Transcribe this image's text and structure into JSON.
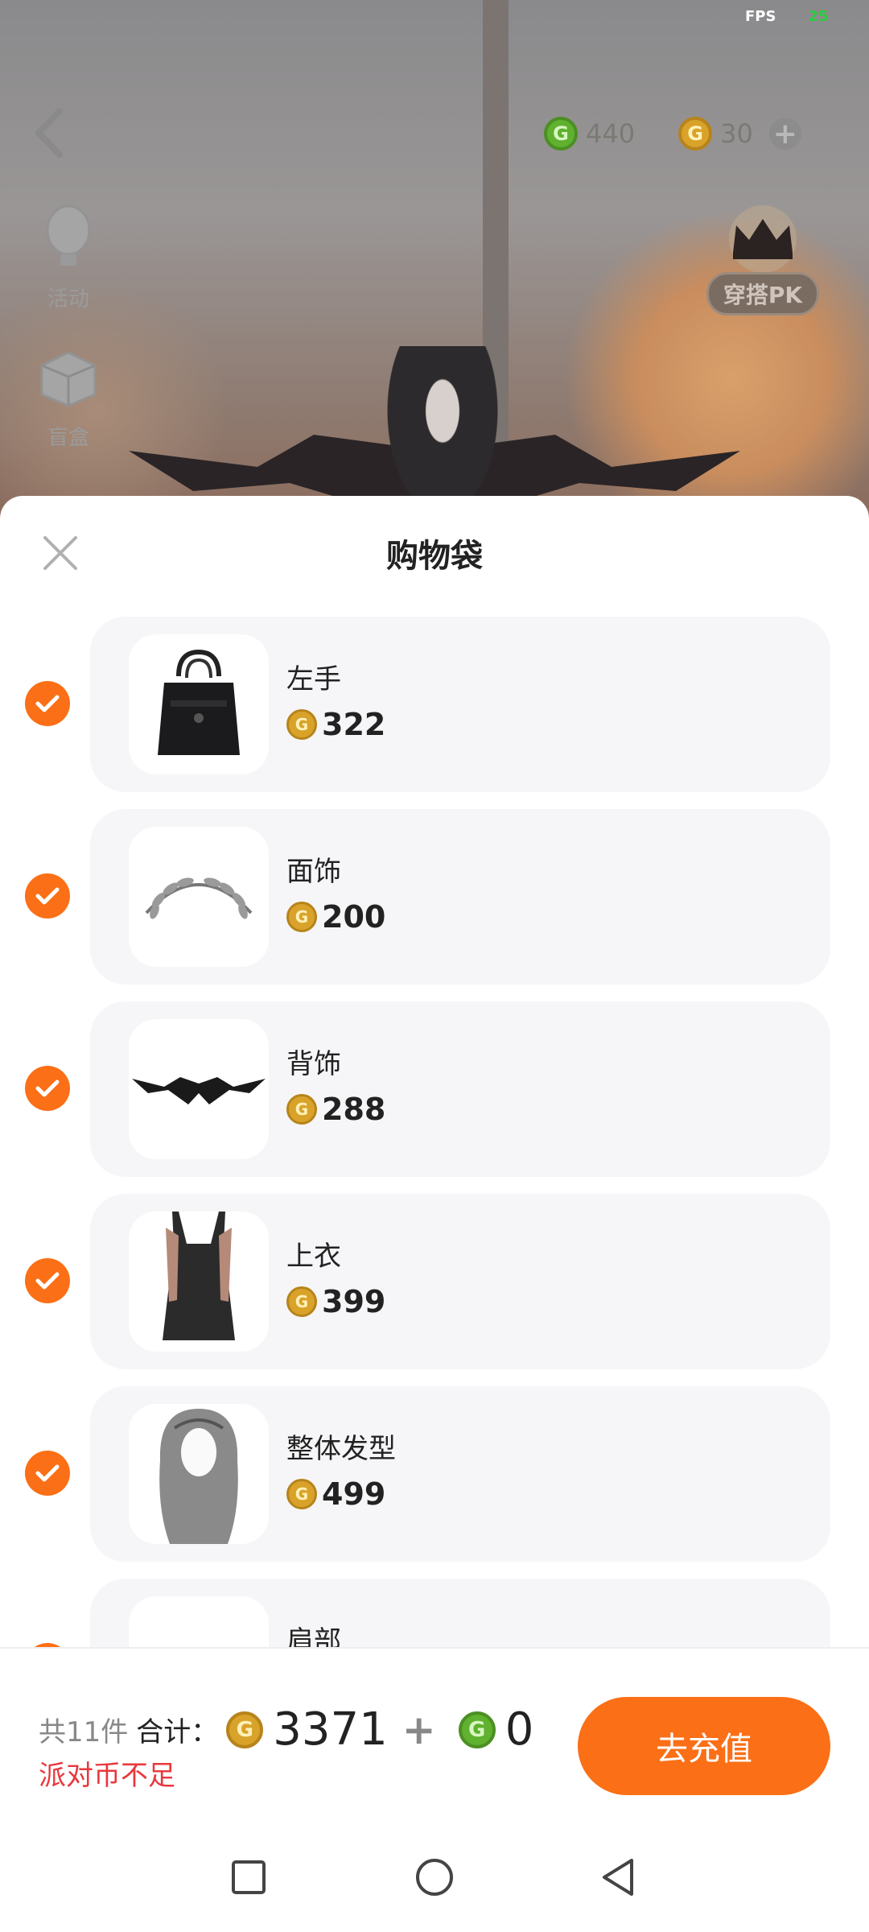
{
  "status": {
    "fps_label": "FPS",
    "fps_value": "25"
  },
  "game": {
    "currency": [
      {
        "type": "green",
        "icon": "g-coin-green-icon",
        "amount": "440"
      },
      {
        "type": "gold",
        "icon": "g-coin-gold-icon",
        "amount": "30"
      }
    ],
    "side_buttons": [
      {
        "label": "活动",
        "icon": "balloon-icon"
      },
      {
        "label": "盲盒",
        "icon": "blind-box-icon"
      }
    ],
    "pk_label": "穿搭PK"
  },
  "sheet": {
    "title": "购物袋",
    "items": [
      {
        "name": "左手",
        "price": "322",
        "checked": true,
        "thumb": "handbag"
      },
      {
        "name": "面饰",
        "price": "200",
        "checked": true,
        "thumb": "laurel-wreath"
      },
      {
        "name": "背饰",
        "price": "288",
        "checked": true,
        "thumb": "bat-wings"
      },
      {
        "name": "上衣",
        "price": "399",
        "checked": true,
        "thumb": "slip-dress"
      },
      {
        "name": "整体发型",
        "price": "499",
        "checked": true,
        "thumb": "long-hair"
      },
      {
        "name": "肩部",
        "price": "",
        "checked": true,
        "thumb": "shoulder"
      }
    ]
  },
  "footer": {
    "count_text": "共11件",
    "total_label": "合计：",
    "gold_total": "3371",
    "plus": "+",
    "green_total": "0",
    "warning": "派对币不足",
    "recharge_label": "去充值"
  },
  "colors": {
    "accent": "#fb6f16",
    "warning": "#e8383d",
    "gold_coin": "#d9a22a",
    "green_coin": "#5fb12f"
  }
}
